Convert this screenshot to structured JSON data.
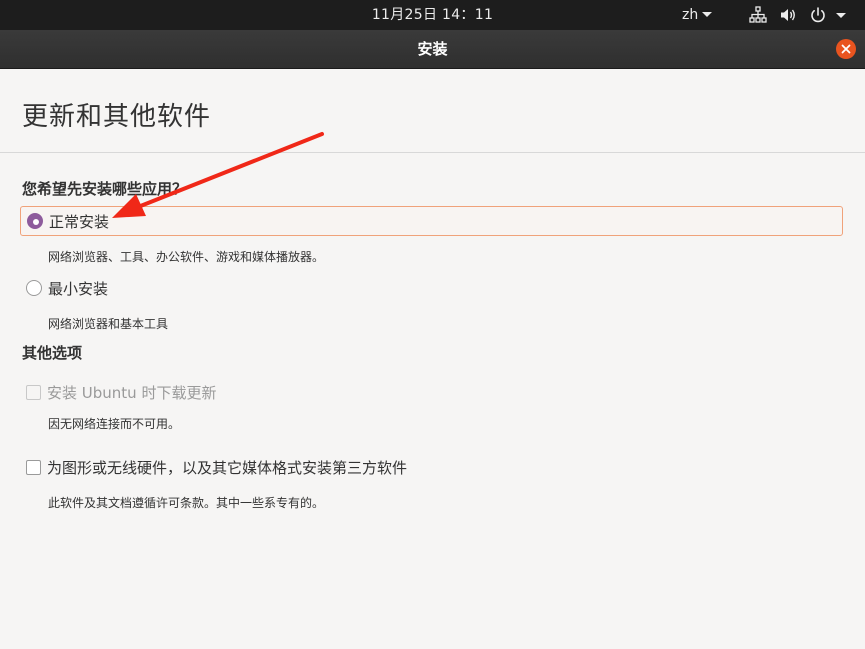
{
  "topbar": {
    "clock": "11月25日  14：11",
    "language": "zh",
    "icons": [
      "network-icon",
      "volume-icon",
      "power-icon"
    ]
  },
  "window": {
    "title": "安装",
    "close_icon": "close-icon"
  },
  "page": {
    "title": "更新和其他软件",
    "question": "您希望先安装哪些应用？",
    "install_options": [
      {
        "label": "正常安装",
        "description": "网络浏览器、工具、办公软件、游戏和媒体播放器。",
        "selected": true
      },
      {
        "label": "最小安装",
        "description": "网络浏览器和基本工具",
        "selected": false
      }
    ],
    "other_options_title": "其他选项",
    "other_options": [
      {
        "label": "安装 Ubuntu 时下载更新",
        "description": "因无网络连接而不可用。",
        "checked": false,
        "enabled": false
      },
      {
        "label": "为图形或无线硬件，以及其它媒体格式安装第三方软件",
        "description": "此软件及其文档遵循许可条款。其中一些系专有的。",
        "checked": false,
        "enabled": true
      }
    ]
  },
  "colors": {
    "accent_radio": "#8e5b9c",
    "selection_border": "#f0a27a",
    "close_button": "#e9541f",
    "annotation_arrow": "#f02818",
    "topbar_bg": "#1d1d1d",
    "titlebar_bg": "#333333",
    "page_bg": "#f6f5f4"
  }
}
